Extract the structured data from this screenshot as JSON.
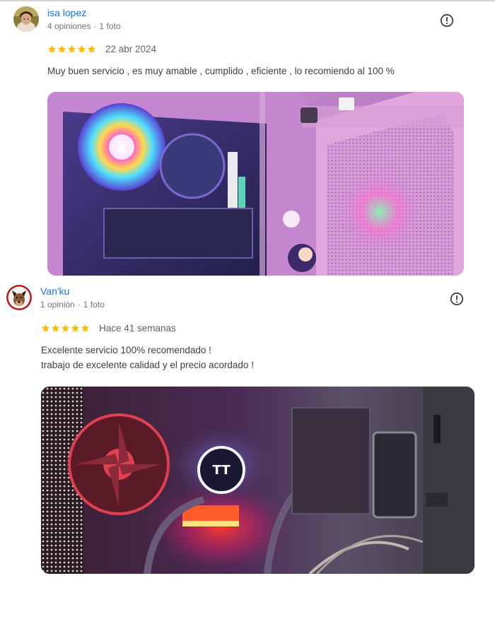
{
  "reviews": [
    {
      "author": "isa lopez",
      "reviews_count": "4 opiniones",
      "photos_count": "1 foto",
      "separator": "·",
      "rating": 5,
      "date": "22 abr 2024",
      "text_lines": [
        "Muy buen servicio , es muy amable , cumplido , eficiente , lo recomiendo al 100 %"
      ],
      "photo_icon": "pink-pc-case-photo",
      "report_icon": "report-icon"
    },
    {
      "author": "Van'ku",
      "reviews_count": "1 opinión",
      "photos_count": "1 foto",
      "separator": "·",
      "rating": 5,
      "date": "Hace 41 semanas",
      "text_lines": [
        "Excelente servicio 100% recomendado !",
        "trabajo de excelente calidad y el precio acordado !"
      ],
      "photo_icon": "pc-interior-rgb-photo",
      "report_icon": "report-icon"
    }
  ],
  "colors": {
    "author": "#1a73e8",
    "star": "#fbbc04",
    "meta": "#70757a",
    "text": "#3c4043"
  }
}
